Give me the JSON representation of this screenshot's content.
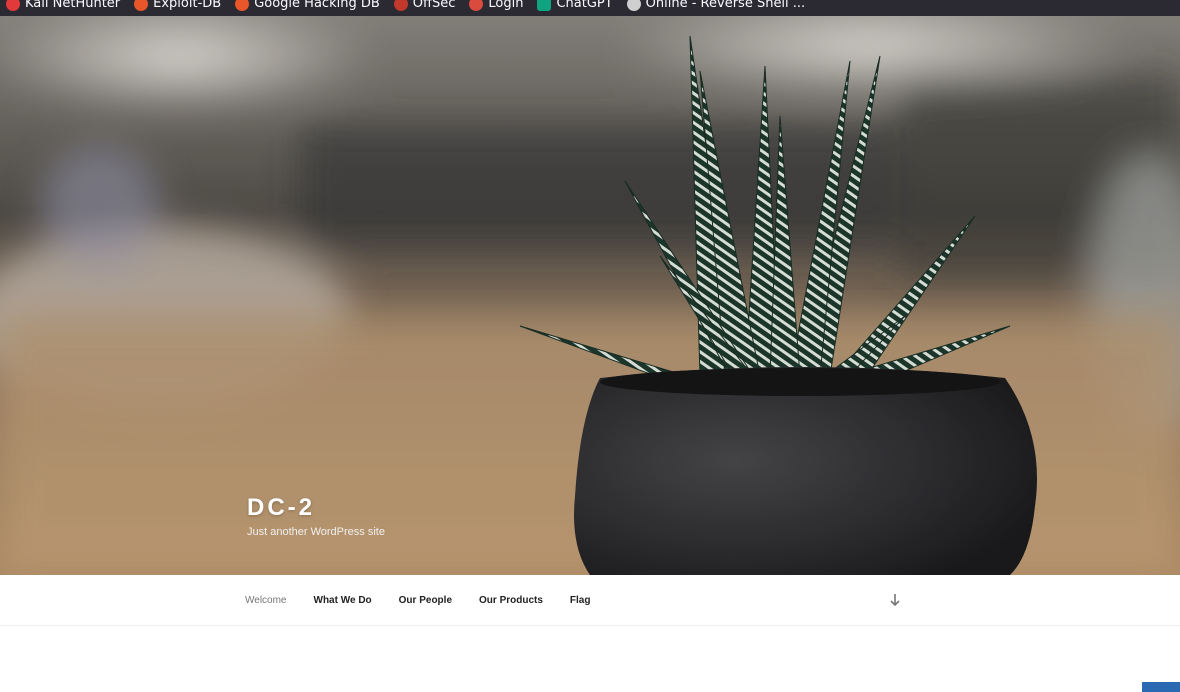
{
  "bookmarks": [
    {
      "label": "Kali NetHunter",
      "icon": "kali-icon",
      "color": "#e23a3a"
    },
    {
      "label": "Exploit-DB",
      "icon": "exploit-db-icon",
      "color": "#e8562a"
    },
    {
      "label": "Google Hacking DB",
      "icon": "ghdb-icon",
      "color": "#e8562a"
    },
    {
      "label": "OffSec",
      "icon": "offsec-icon",
      "color": "#c0392b"
    },
    {
      "label": "Login",
      "icon": "login-icon",
      "color": "#d94b3d"
    },
    {
      "label": "ChatGPT",
      "icon": "chatgpt-icon",
      "color": "#10a37f"
    },
    {
      "label": "Online - Reverse Shell ...",
      "icon": "skull-icon",
      "color": "#cfcfcf"
    }
  ],
  "site": {
    "title": "DC-2",
    "description": "Just another WordPress site"
  },
  "menu": {
    "items": [
      "Welcome",
      "What We Do",
      "Our People",
      "Our Products",
      "Flag"
    ],
    "current": "Welcome"
  },
  "colors": {
    "toolbar": "#2b2a33",
    "accent": "#2a6ab3",
    "menu_text": "#222222",
    "menu_current": "#767676"
  }
}
